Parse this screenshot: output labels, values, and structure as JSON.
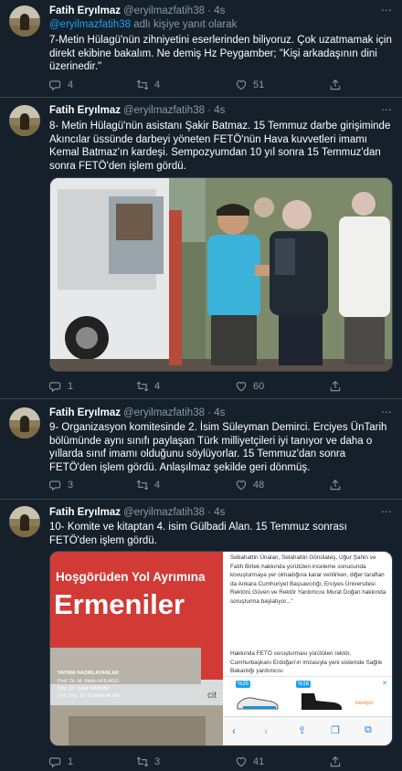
{
  "tweets": [
    {
      "name": "Fatih Eryılmaz",
      "handle": "@eryilmazfatih38 · 4s",
      "reply_mention": "@eryilmazfatih38",
      "reply_suffix": " adlı kişiye yanıt olarak",
      "text": "7-Metin Hülagü'nün zihniyetini eserlerinden biliyoruz. Çok uzatmamak için direkt ekibine bakalım. Ne demiş Hz Peygamber; \"Kişi arkadaşının dini üzerinedir.\"",
      "reply_count": "4",
      "retweet_count": "4",
      "like_count": "51"
    },
    {
      "name": "Fatih Eryılmaz",
      "handle": "@eryilmazfatih38 · 4s",
      "text": "8- Metin Hülagü'nün asistanı Şakir Batmaz. 15 Temmuz darbe girişiminde Akıncılar üssünde darbeyi yöneten FETÖ'nün Hava kuvvetleri imamı Kemal Batmaz'ın kardeşi. Sempozyumdan 10 yıl sonra 15 Temmuz'dan sonra FETÖ'den işlem gördü.",
      "reply_count": "1",
      "retweet_count": "4",
      "like_count": "60"
    },
    {
      "name": "Fatih Eryılmaz",
      "handle": "@eryilmazfatih38 · 4s",
      "text": "9- Organizasyon komitesinde 2. İsim Süleyman Demirci. Erciyes ÜnTarih bölümünde aynı sınıfı paylaşan Türk milliyetçileri iyi tanıyor ve daha o yıllarda sınıf imamı olduğunu söylüyorlar. 15 Temmuz'dan sonra FETÖ'den işlem gördü. Anlaşılmaz şekilde geri dönmüş.",
      "reply_count": "3",
      "retweet_count": "4",
      "like_count": "48"
    },
    {
      "name": "Fatih Eryılmaz",
      "handle": "@eryilmazfatih38 · 4s",
      "text": "10- Komite ve kitaptan 4. isim Gülbadi Alan. 15 Temmuz sonrası FETÖ'den işlem gördü.",
      "reply_count": "1",
      "retweet_count": "3",
      "like_count": "41"
    }
  ],
  "book": {
    "subtitle": "Hoşgörüden Yol Ayrımına",
    "title": "Ermeniler",
    "editors_heading": "YAYINA HAZIRLAYANLAR",
    "editor1": "Prof. Dr. M. Metin HÜLAGÜ",
    "editor2": "Doç. Dr. Şakir BATMAZ",
    "editor3": "Yrd. Doç. Dr. Gülbadi ALAN",
    "publisher_fragment": "cit"
  },
  "article": {
    "para1": "Sebahattin Ünalan, Selahattin Gönülateş, Uğur Şahin ve Fatih Birtek hakkında yürütülen inceleme sonucunda kovuşturmaya yer olmadığına karar verilirken, diğer taraftan da Ankara Cumhuriyet Başsavcılığı, Erciyes Üniversitesi Rektörü Güven ve Rektör Yardımcısı Murat Doğan hakkında soruşturma başlatıyor...\"",
    "para2": "Hakkında FETÖ soruşturması yürütülen rektör, Cumhurbaşkanı Erdoğan'ın imzasıyla yeni sistemde Sağlık Bakanlığı yardımcısı",
    "ad_badge1": "%25",
    "ad_badge2": "%16",
    "ad_brand": "trendyol"
  },
  "colors": {
    "background": "#15202b",
    "muted": "#8899a6",
    "link": "#1da1f2",
    "divider": "#38444d"
  }
}
